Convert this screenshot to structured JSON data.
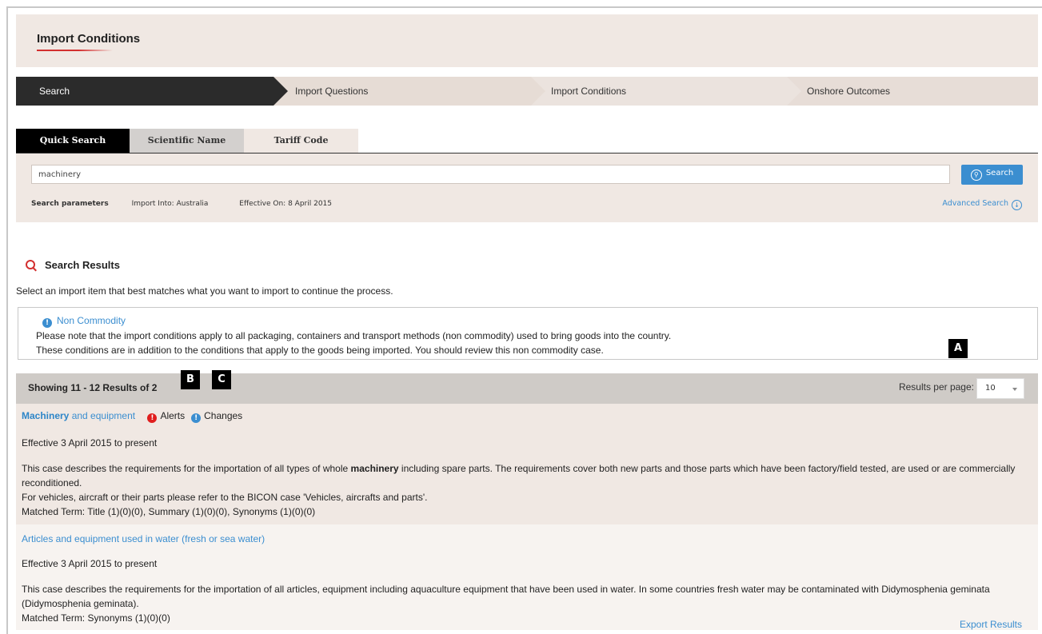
{
  "page": {
    "title": "Import Conditions"
  },
  "steps": [
    "Search",
    "Import Questions",
    "Import Conditions",
    "Onshore Outcomes"
  ],
  "tabs": [
    "Quick Search",
    "Scientific Name",
    "Tariff Code"
  ],
  "search": {
    "value": "machinery",
    "button_label": "Search",
    "params_label": "Search parameters",
    "import_into": "Import Into: Australia",
    "effective_on": "Effective On: 8 April 2015",
    "advanced_label": "Advanced Search"
  },
  "results": {
    "heading": "Search Results",
    "subtext": "Select an import item that best matches what you want to import to continue the process.",
    "note": {
      "title": "Non Commodity",
      "line1": "Please note that the import conditions apply to all packaging, containers and transport methods (non commodity) used to bring goods into the country.",
      "line2": "These conditions are in addition to the conditions that apply to the goods being imported. You should review this non commodity case."
    },
    "showing": "Showing 11 - 12 Results of 2",
    "per_page_label": "Results per page:",
    "per_page_value": "10",
    "badges": {
      "a": "A",
      "b": "B",
      "c": "C"
    },
    "items": [
      {
        "title_bold": "Machinery",
        "title_rest": " and equipment",
        "alerts_label": "Alerts",
        "changes_label": "Changes",
        "effective": "Effective 3 April 2015 to present",
        "desc_pre": "This case describes the requirements for the importation of all types of whole ",
        "desc_bold": "machinery",
        "desc_post": " including spare parts. The requirements cover both new parts and those parts which have been factory/field tested, are used or are commercially reconditioned.",
        "desc_line2": "For vehicles, aircraft or their parts please refer to the BICON case 'Vehicles, aircrafts and parts'.",
        "matched": "Matched Term: Title (1)(0)(0), Summary (1)(0)(0), Synonyms (1)(0)(0)"
      },
      {
        "title": "Articles and equipment used in water (fresh or sea water)",
        "effective": "Effective 3 April 2015 to present",
        "desc": "This case describes the requirements for the importation of all articles, equipment including aquaculture equipment that have been used in water. In some countries fresh water may be contaminated with Didymosphenia geminata (Didymosphenia geminata).",
        "matched": "Matched Term: Synonyms (1)(0)(0)"
      }
    ],
    "export_label": "Export Results"
  }
}
